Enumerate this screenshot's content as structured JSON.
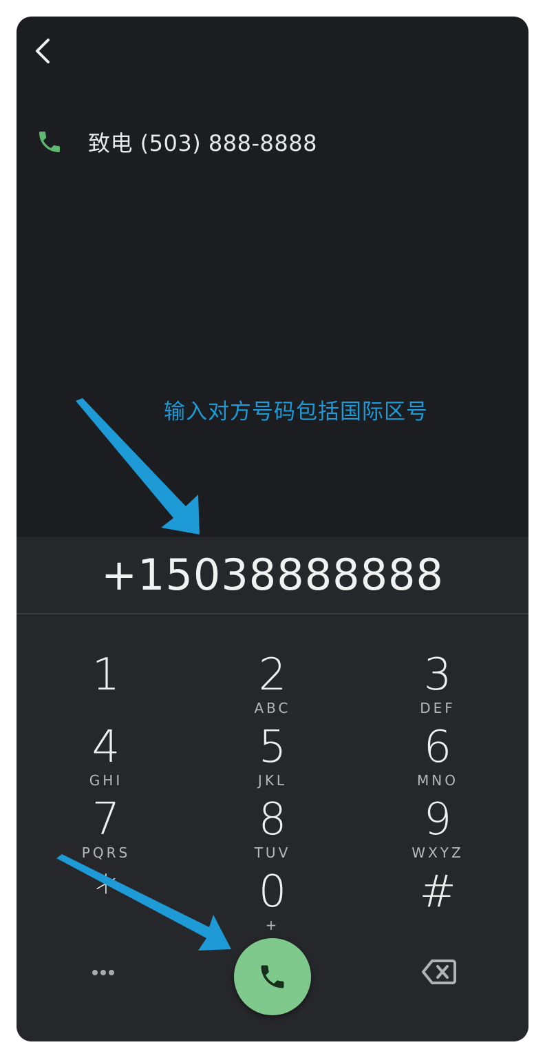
{
  "header": {
    "back_icon": "chevron-left-icon"
  },
  "suggestion": {
    "icon": "phone-icon",
    "label": "致电 (503) 888-8888",
    "icon_color": "#5fb872"
  },
  "annotation": {
    "text": "输入对方号码包括国际区号",
    "color": "#1e9ad6"
  },
  "dialer": {
    "number": "+15038888888"
  },
  "keypad": {
    "keys": [
      {
        "digit": "1",
        "letters": ""
      },
      {
        "digit": "2",
        "letters": "ABC"
      },
      {
        "digit": "3",
        "letters": "DEF"
      },
      {
        "digit": "4",
        "letters": "GHI"
      },
      {
        "digit": "5",
        "letters": "JKL"
      },
      {
        "digit": "6",
        "letters": "MNO"
      },
      {
        "digit": "7",
        "letters": "PQRS"
      },
      {
        "digit": "8",
        "letters": "TUV"
      },
      {
        "digit": "9",
        "letters": "WXYZ"
      },
      {
        "digit": "*",
        "letters": ""
      },
      {
        "digit": "0",
        "letters": "+"
      },
      {
        "digit": "#",
        "letters": ""
      }
    ]
  },
  "actions": {
    "more_icon": "more-dots-icon",
    "call_icon": "phone-icon",
    "call_color": "#7fc98d",
    "backspace_icon": "backspace-icon"
  }
}
